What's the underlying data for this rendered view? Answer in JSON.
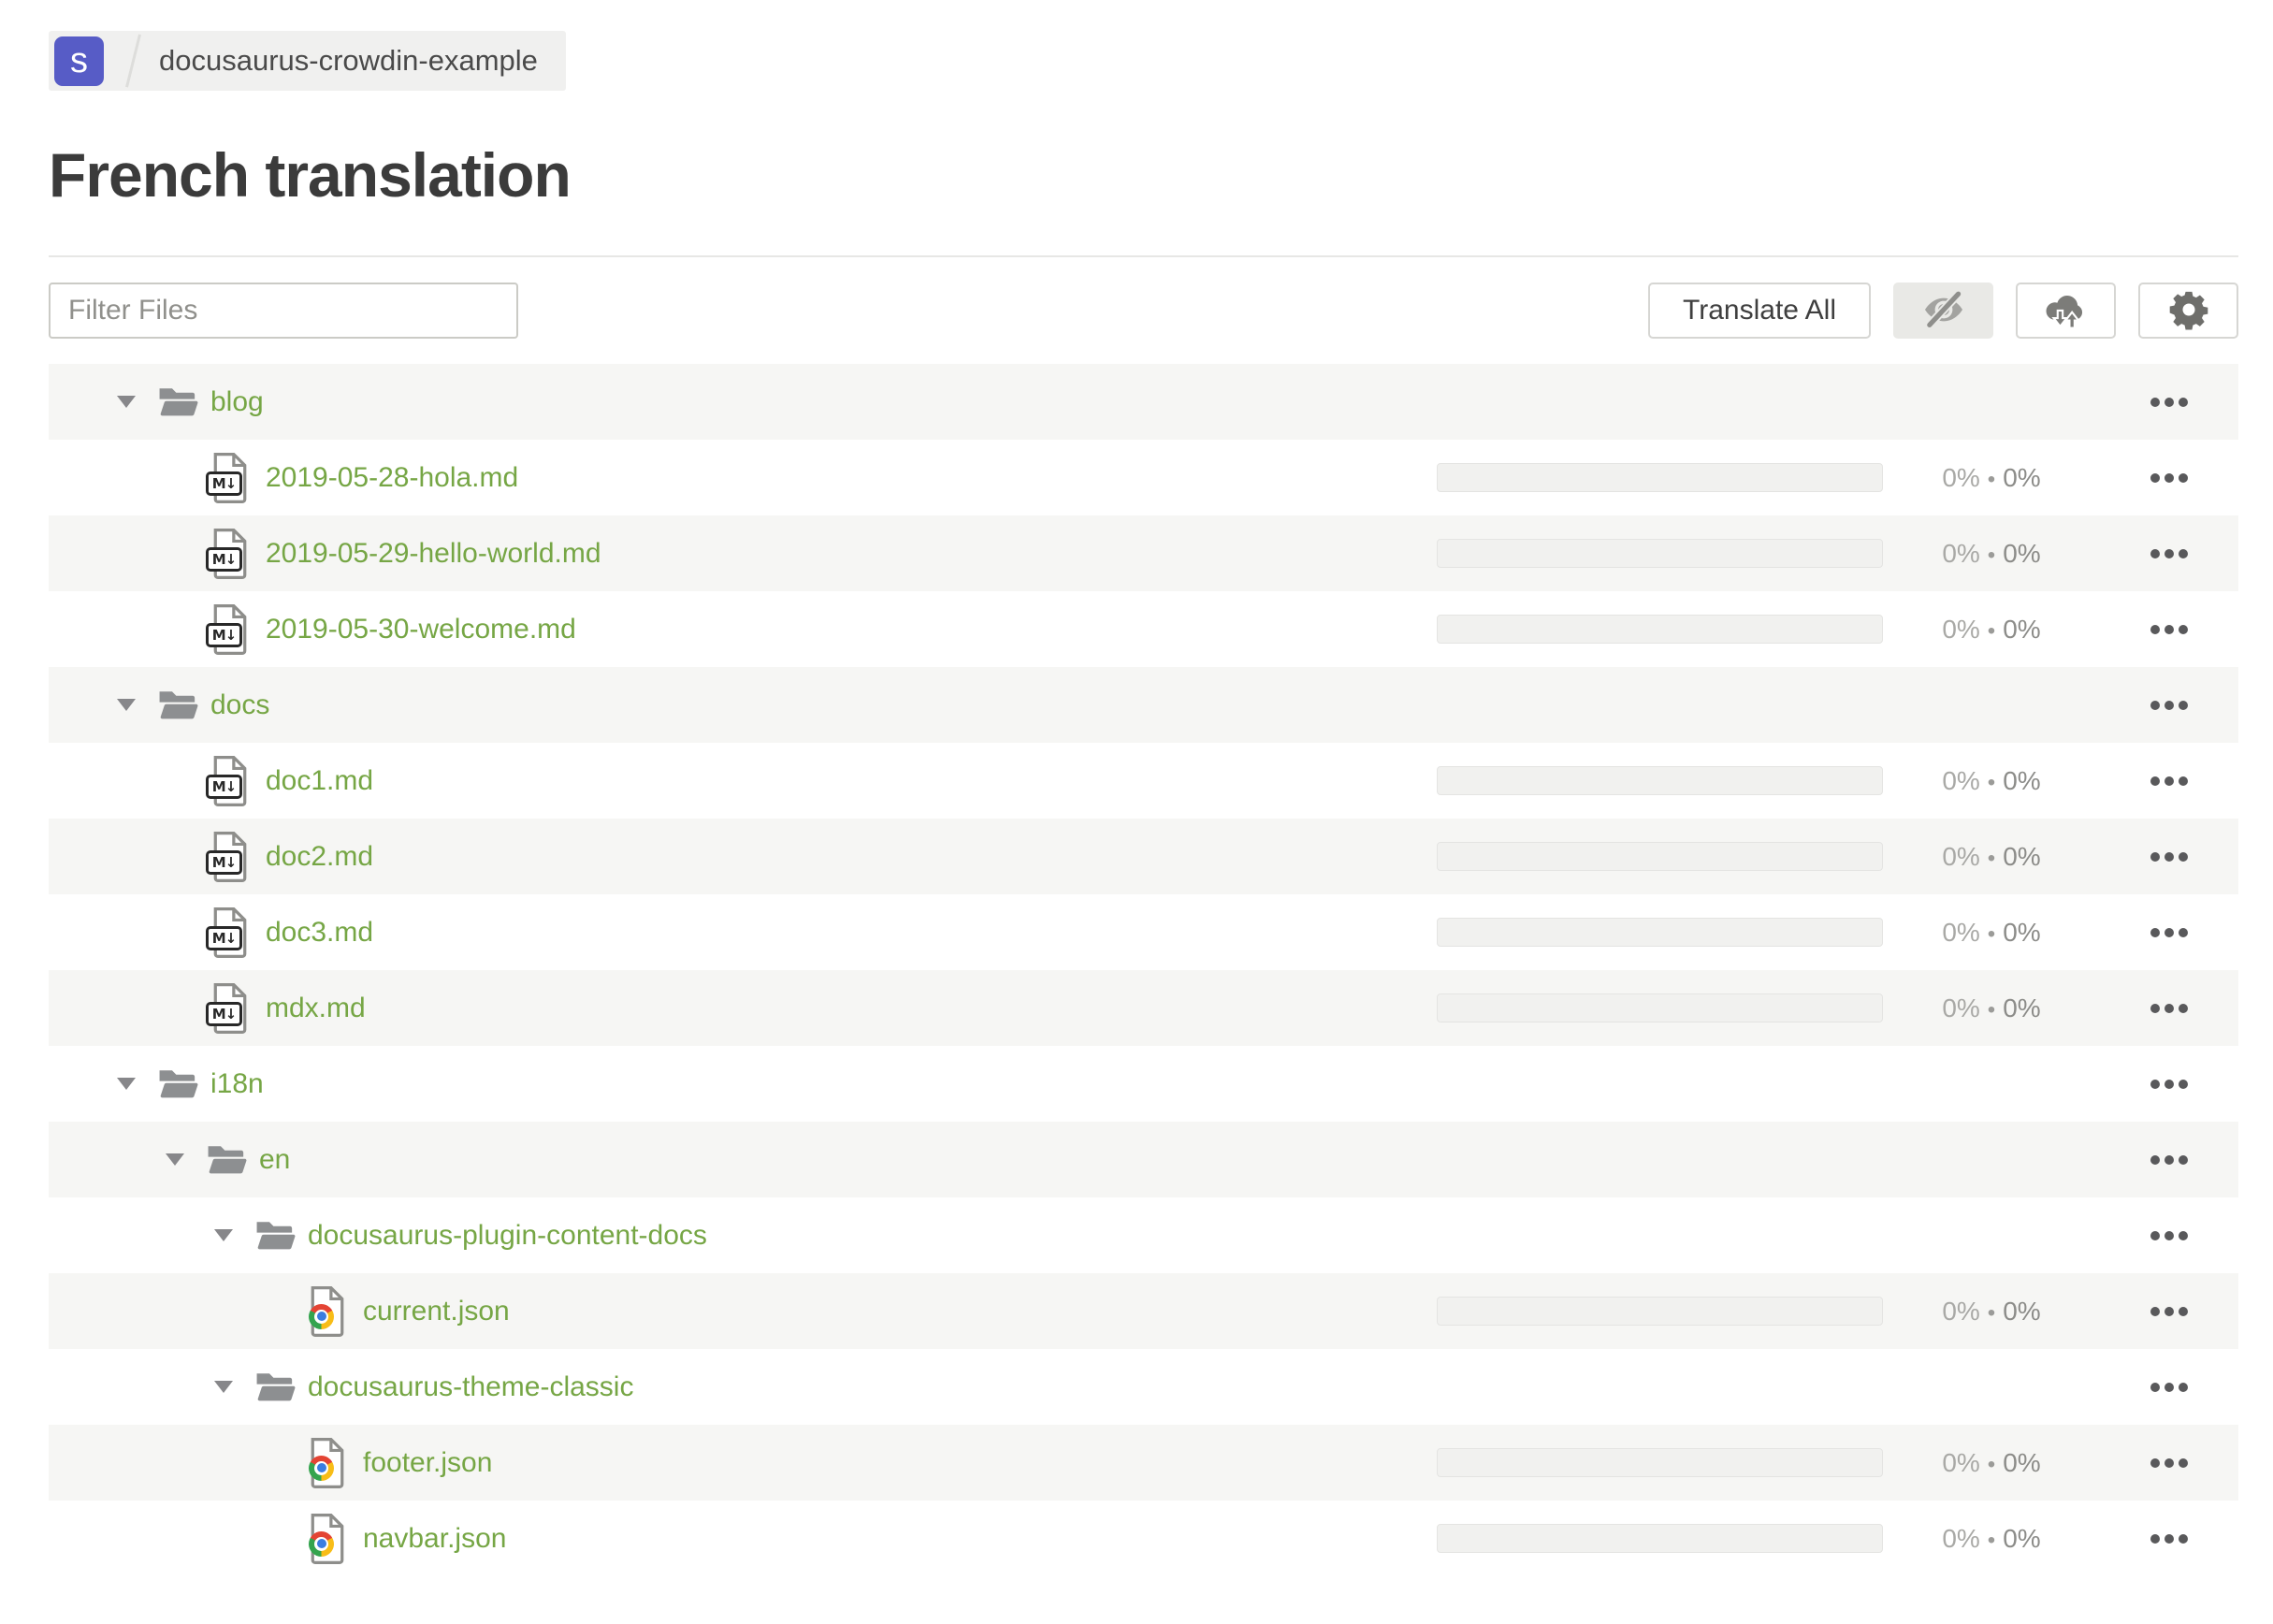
{
  "breadcrumb": {
    "badge_letter": "s",
    "project_name": "docusaurus-crowdin-example"
  },
  "page": {
    "title": "French translation"
  },
  "toolbar": {
    "filter_placeholder": "Filter Files",
    "filter_value": "",
    "translate_all_label": "Translate All",
    "icon_buttons": [
      {
        "name": "hide-completed-button",
        "icon": "eye-off-icon",
        "active": true
      },
      {
        "name": "sync-files-button",
        "icon": "cloud-download-upload-icon",
        "active": false
      },
      {
        "name": "settings-button",
        "icon": "gear-icon",
        "active": false
      }
    ]
  },
  "colors": {
    "accent_green": "#76a645",
    "badge_indigo": "#575cc6",
    "row_stripe": "#f6f6f4",
    "folder_gray": "#8d8f91",
    "progress_track": "#f1f1ef",
    "stats_light": "#a9a9a6",
    "stats_dark": "#8c8c89"
  },
  "tree": {
    "stats_separator": "•",
    "rows": [
      {
        "type": "folder",
        "level": 0,
        "label": "blog",
        "expanded": true
      },
      {
        "type": "file",
        "kind": "md",
        "level": 1,
        "label": "2019-05-28-hola.md",
        "progress_percent": 0,
        "translated": "0%",
        "approved": "0%"
      },
      {
        "type": "file",
        "kind": "md",
        "level": 1,
        "label": "2019-05-29-hello-world.md",
        "progress_percent": 0,
        "translated": "0%",
        "approved": "0%"
      },
      {
        "type": "file",
        "kind": "md",
        "level": 1,
        "label": "2019-05-30-welcome.md",
        "progress_percent": 0,
        "translated": "0%",
        "approved": "0%"
      },
      {
        "type": "folder",
        "level": 0,
        "label": "docs",
        "expanded": true
      },
      {
        "type": "file",
        "kind": "md",
        "level": 1,
        "label": "doc1.md",
        "progress_percent": 0,
        "translated": "0%",
        "approved": "0%"
      },
      {
        "type": "file",
        "kind": "md",
        "level": 1,
        "label": "doc2.md",
        "progress_percent": 0,
        "translated": "0%",
        "approved": "0%"
      },
      {
        "type": "file",
        "kind": "md",
        "level": 1,
        "label": "doc3.md",
        "progress_percent": 0,
        "translated": "0%",
        "approved": "0%"
      },
      {
        "type": "file",
        "kind": "md",
        "level": 1,
        "label": "mdx.md",
        "progress_percent": 0,
        "translated": "0%",
        "approved": "0%"
      },
      {
        "type": "folder",
        "level": 0,
        "label": "i18n",
        "expanded": true
      },
      {
        "type": "folder",
        "level": 1,
        "label": "en",
        "expanded": true
      },
      {
        "type": "folder",
        "level": 2,
        "label": "docusaurus-plugin-content-docs",
        "expanded": true
      },
      {
        "type": "file",
        "kind": "json",
        "level": 3,
        "label": "current.json",
        "progress_percent": 0,
        "translated": "0%",
        "approved": "0%"
      },
      {
        "type": "folder",
        "level": 2,
        "label": "docusaurus-theme-classic",
        "expanded": true
      },
      {
        "type": "file",
        "kind": "json",
        "level": 3,
        "label": "footer.json",
        "progress_percent": 0,
        "translated": "0%",
        "approved": "0%"
      },
      {
        "type": "file",
        "kind": "json",
        "level": 3,
        "label": "navbar.json",
        "progress_percent": 0,
        "translated": "0%",
        "approved": "0%"
      }
    ]
  }
}
